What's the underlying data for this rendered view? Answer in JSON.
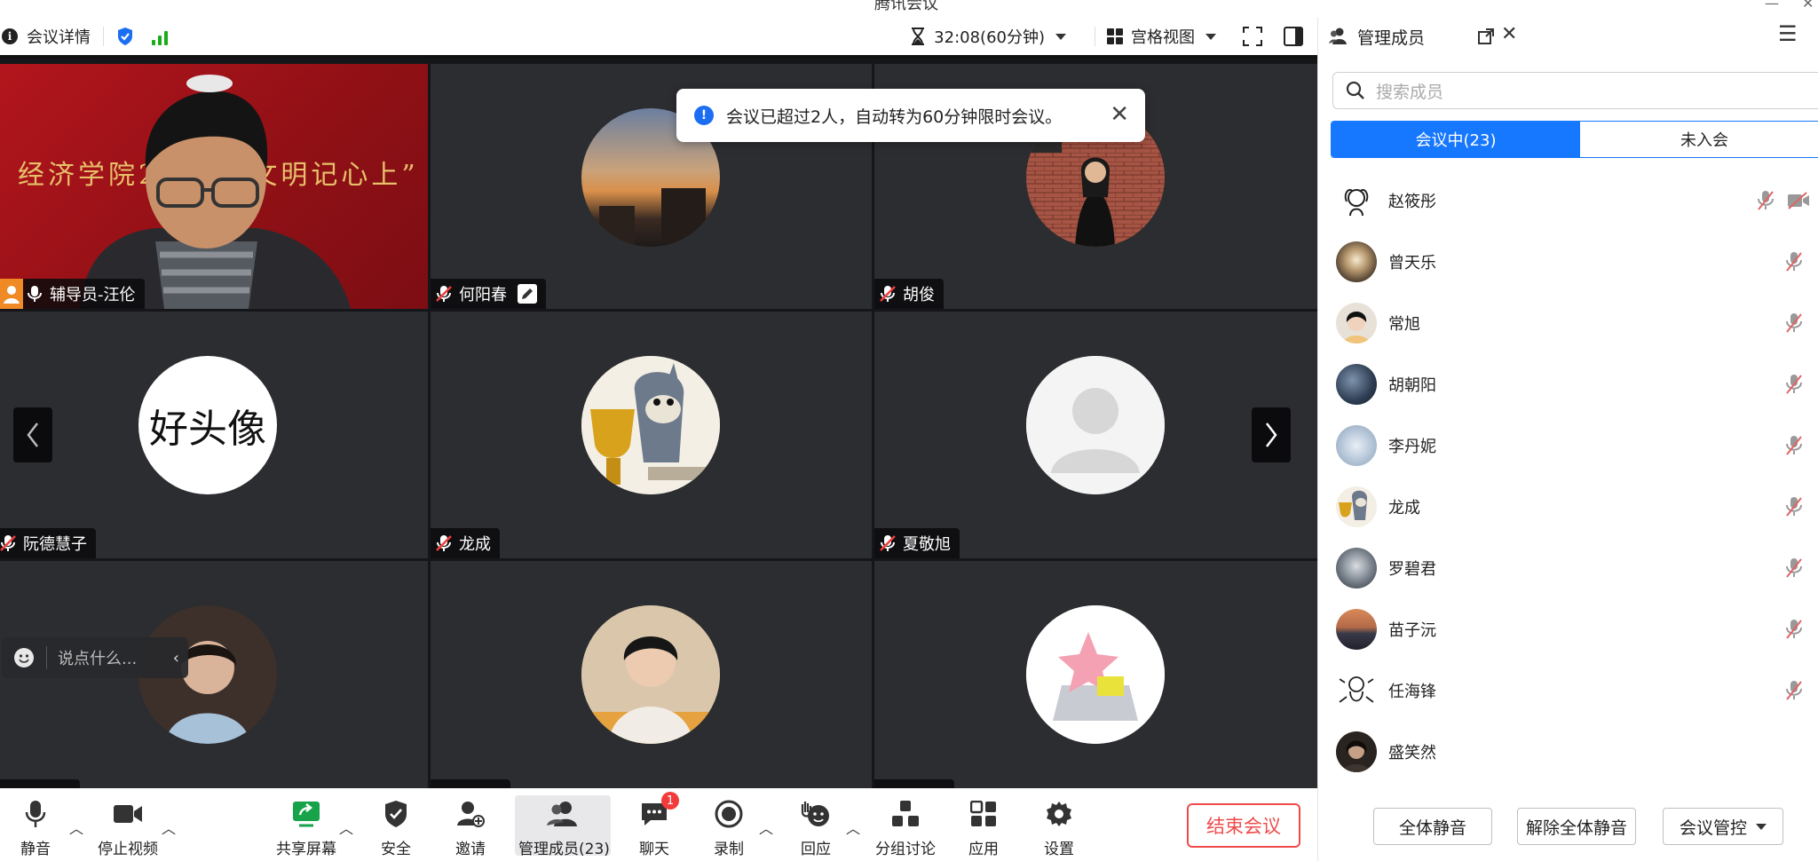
{
  "window": {
    "title": "腾讯会议",
    "minimize_icon": "minimize-icon",
    "close_icon": "close-icon"
  },
  "topbar": {
    "meeting_details": "会议详情",
    "timer": "32:08(60分钟)",
    "view_mode": "宫格视图",
    "signal_color": "#1aad19",
    "shield_color": "#1b6ef3"
  },
  "notification": {
    "text": "会议已超过2人，自动转为60分钟限时会议。"
  },
  "video_tiles": [
    {
      "name": "辅导员-汪伦",
      "type": "camera",
      "muted": false
    },
    {
      "name": "何阳春",
      "type": "avatar",
      "muted": true
    },
    {
      "name": "胡俊",
      "type": "avatar",
      "muted": true
    },
    {
      "name": "阮德慧子",
      "type": "avatar",
      "muted": true,
      "avatar_text": "好头像"
    },
    {
      "name": "龙成",
      "type": "avatar",
      "muted": true
    },
    {
      "name": "夏敬旭",
      "type": "avatar",
      "muted": true
    },
    {
      "name": "",
      "type": "avatar",
      "muted": true
    },
    {
      "name": "",
      "type": "avatar",
      "muted": true
    },
    {
      "name": "",
      "type": "avatar",
      "muted": true
    }
  ],
  "camera_banner": "经济学院2023…文明记心上”",
  "chat_input": {
    "placeholder": "说点什么..."
  },
  "toolbar": {
    "mute": "静音",
    "stop_video": "停止视频",
    "share_screen": "共享屏幕",
    "security": "安全",
    "invite": "邀请",
    "manage_members": "管理成员(23)",
    "chat": "聊天",
    "chat_badge": "1",
    "record": "录制",
    "reactions": "回应",
    "breakout": "分组讨论",
    "apps": "应用",
    "settings": "设置",
    "end_meeting": "结束会议"
  },
  "panel": {
    "title": "管理成员",
    "search_placeholder": "搜索成员",
    "tab_in_meeting": "会议中(23)",
    "tab_not_joined": "未入会",
    "members": [
      {
        "name": "赵筱彤",
        "muted": true,
        "video_off": true
      },
      {
        "name": "曾天乐",
        "muted": true
      },
      {
        "name": "常旭",
        "muted": true
      },
      {
        "name": "胡朝阳",
        "muted": true
      },
      {
        "name": "李丹妮",
        "muted": true
      },
      {
        "name": "龙成",
        "muted": true
      },
      {
        "name": "罗碧君",
        "muted": true
      },
      {
        "name": "苗子沅",
        "muted": true
      },
      {
        "name": "任海锋",
        "muted": true
      },
      {
        "name": "盛笑然",
        "muted": false
      }
    ],
    "mute_all": "全体静音",
    "unmute_all": "解除全体静音",
    "meeting_control": "会议管控"
  },
  "colors": {
    "accent": "#1677ff",
    "danger": "#f04a4a",
    "grid_bg": "#2c2d30"
  }
}
